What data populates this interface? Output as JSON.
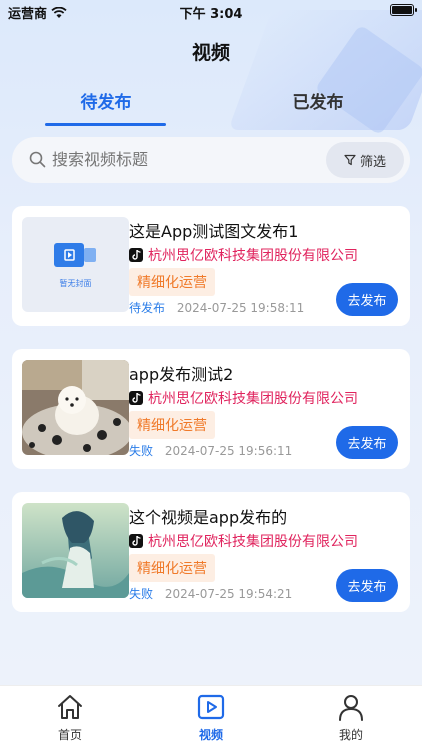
{
  "status_bar": {
    "carrier": "运营商",
    "time": "下午 3:04"
  },
  "header": {
    "title": "视频"
  },
  "tabs": [
    {
      "label": "待发布",
      "active": true
    },
    {
      "label": "已发布",
      "active": false
    }
  ],
  "search": {
    "placeholder": "搜索视频标题",
    "filter_label": "筛选"
  },
  "placeholder_label": "暂无封面",
  "cards": [
    {
      "title": "这是App测试图文发布1",
      "company": "杭州思亿欧科技集团股份有限公司",
      "tag": "精细化运营",
      "status": "待发布",
      "time": "2024-07-25 19:58:11",
      "button": "去发布"
    },
    {
      "title": "app发布测试2",
      "company": "杭州思亿欧科技集团股份有限公司",
      "tag": "精细化运营",
      "status": "失败",
      "time": "2024-07-25 19:56:11",
      "button": "去发布"
    },
    {
      "title": "这个视频是app发布的",
      "company": "杭州思亿欧科技集团股份有限公司",
      "tag": "精细化运营",
      "status": "失败",
      "time": "2024-07-25 19:54:21",
      "button": "去发布"
    }
  ],
  "tabbar": [
    {
      "label": "首页",
      "icon": "home-icon"
    },
    {
      "label": "视频",
      "icon": "video-icon",
      "active": true
    },
    {
      "label": "我的",
      "icon": "user-icon"
    }
  ],
  "colors": {
    "accent": "#1f6ae8",
    "company": "#e0245e",
    "tag_text": "#f07a2a",
    "tag_bg": "#fdeee3"
  }
}
